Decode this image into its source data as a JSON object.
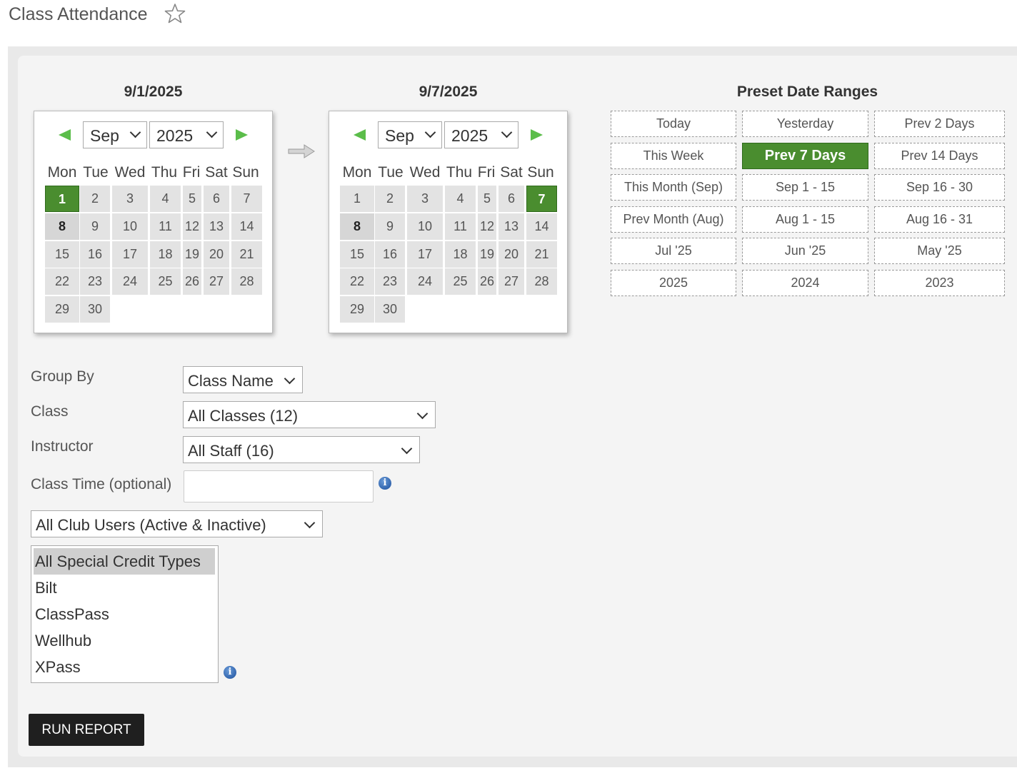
{
  "page": {
    "title": "Class Attendance"
  },
  "calendars": [
    {
      "header": "9/1/2025",
      "month": "Sep",
      "year": "2025",
      "dow": [
        "Mon",
        "Tue",
        "Wed",
        "Thu",
        "Fri",
        "Sat",
        "Sun"
      ],
      "weeks": [
        [
          "1",
          "2",
          "3",
          "4",
          "5",
          "6",
          "7"
        ],
        [
          "8",
          "9",
          "10",
          "11",
          "12",
          "13",
          "14"
        ],
        [
          "15",
          "16",
          "17",
          "18",
          "19",
          "20",
          "21"
        ],
        [
          "22",
          "23",
          "24",
          "25",
          "26",
          "27",
          "28"
        ],
        [
          "29",
          "30"
        ]
      ],
      "selected": "1",
      "today": "8"
    },
    {
      "header": "9/7/2025",
      "month": "Sep",
      "year": "2025",
      "dow": [
        "Mon",
        "Tue",
        "Wed",
        "Thu",
        "Fri",
        "Sat",
        "Sun"
      ],
      "weeks": [
        [
          "1",
          "2",
          "3",
          "4",
          "5",
          "6",
          "7"
        ],
        [
          "8",
          "9",
          "10",
          "11",
          "12",
          "13",
          "14"
        ],
        [
          "15",
          "16",
          "17",
          "18",
          "19",
          "20",
          "21"
        ],
        [
          "22",
          "23",
          "24",
          "25",
          "26",
          "27",
          "28"
        ],
        [
          "29",
          "30"
        ]
      ],
      "selected": "7",
      "today": "8"
    }
  ],
  "presets": {
    "title": "Preset Date Ranges",
    "buttons": [
      [
        "Today",
        "Yesterday",
        "Prev 2 Days"
      ],
      [
        "This Week",
        "Prev 7 Days",
        "Prev 14 Days"
      ],
      [
        "This Month (Sep)",
        "Sep 1 - 15",
        "Sep 16 - 30"
      ],
      [
        "Prev Month (Aug)",
        "Aug 1 - 15",
        "Aug 16 - 31"
      ],
      [
        "Jul '25",
        "Jun '25",
        "May '25"
      ],
      [
        "2025",
        "2024",
        "2023"
      ]
    ],
    "active": "Prev 7 Days"
  },
  "form": {
    "group_by": {
      "label": "Group By",
      "value": "Class Name"
    },
    "class": {
      "label": "Class",
      "value": "All Classes (12)"
    },
    "instructor": {
      "label": "Instructor",
      "value": "All Staff (16)"
    },
    "class_time": {
      "label": "Class Time (optional)",
      "value": ""
    },
    "users": {
      "value": "All Club Users (Active & Inactive)"
    },
    "credit_types": {
      "items": [
        "All Special Credit Types",
        "Bilt",
        "ClassPass",
        "Wellhub",
        "XPass"
      ],
      "selected": "All Special Credit Types"
    }
  },
  "run_report": {
    "label": "RUN REPORT"
  },
  "colors": {
    "accent_green": "#4a8d2f",
    "arrow_green": "#5bbd4a",
    "info_blue": "#1b4f9c"
  },
  "icons": [
    "star-icon",
    "prev-month-arrow-icon",
    "next-month-arrow-icon",
    "range-arrow-icon",
    "info-icon",
    "chevron-down-icon"
  ]
}
